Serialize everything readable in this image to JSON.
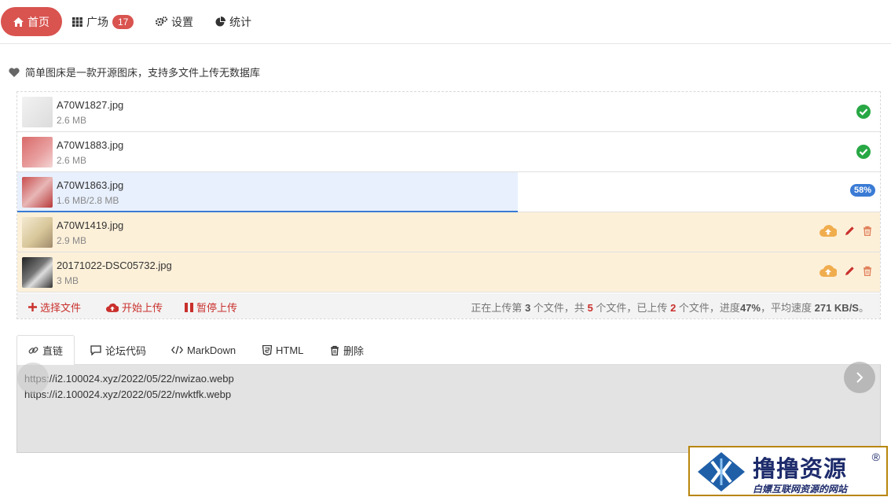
{
  "nav": {
    "home": "首页",
    "square": "广场",
    "square_count": "17",
    "settings": "设置",
    "stats": "统计"
  },
  "tagline": "简单图床是一款开源图床，支持多文件上传无数据库",
  "files": [
    {
      "name": "A70W1827.jpg",
      "size": "2.6 MB"
    },
    {
      "name": "A70W1883.jpg",
      "size": "2.6 MB"
    },
    {
      "name": "A70W1863.jpg",
      "size": "1.6 MB/2.8 MB",
      "progress": 0.58,
      "percent_label": "58%"
    },
    {
      "name": "A70W1419.jpg",
      "size": "2.9 MB"
    },
    {
      "name": "20171022-DSC05732.jpg",
      "size": "3 MB"
    }
  ],
  "toolbar": {
    "select": "选择文件",
    "start": "开始上传",
    "pause": "暂停上传",
    "status_pre": "正在上传第",
    "current": "3",
    "status_mid1": "个文件，共",
    "total": "5",
    "status_mid2": "个文件，已上传",
    "done": "2",
    "status_mid3": "个文件，进度",
    "progress": "47%",
    "status_mid4": "，平均速度",
    "speed": "271 KB/S",
    "status_end": "。"
  },
  "tabs": [
    "直链",
    "论坛代码",
    "MarkDown",
    "HTML",
    "删除"
  ],
  "links": [
    "https://i2.100024.xyz/2022/05/22/nwizao.webp",
    "https://i2.100024.xyz/2022/05/22/nwktfk.webp"
  ],
  "watermark": {
    "title": "撸撸资源",
    "subtitle": "白嫖互联网资源的网站",
    "reg": "®"
  },
  "colors": {
    "accent": "#d9534f",
    "success": "#28a745",
    "info": "#3a7bd5",
    "pending_bg": "#fdf0d9",
    "upload_icon": "#f0ad4e"
  }
}
